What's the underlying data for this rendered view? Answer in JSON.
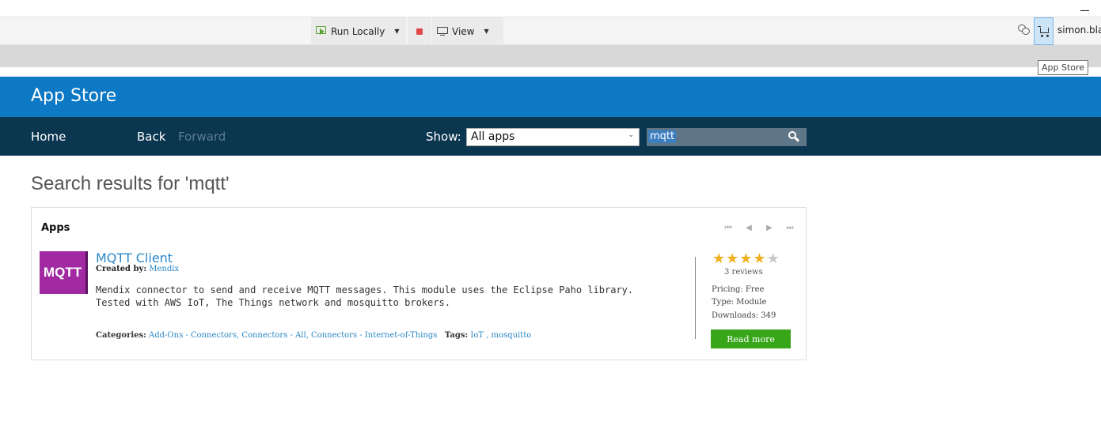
{
  "toolbar": {
    "run_label": "Run Locally",
    "view_label": "View",
    "user_name": "simon.blac",
    "tooltip": "App Store"
  },
  "store": {
    "title": "App Store",
    "nav": {
      "home": "Home",
      "back": "Back",
      "forward": "Forward"
    },
    "show_label": "Show:",
    "show_selected": "All apps",
    "search_value": "mqtt"
  },
  "results": {
    "title": "Search results for 'mqtt'",
    "section_heading": "Apps",
    "items": [
      {
        "logo_text": "MQTT",
        "name": "MQTT Client",
        "created_label": "Created by:",
        "creator": "Mendix",
        "description": "Mendix connector to send and receive MQTT messages. This module uses the Eclipse Paho library. Tested with AWS IoT, The Things network and mosquitto brokers.",
        "categories_label": "Categories:",
        "categories": "Add-Ons - Connectors, Connectors - All, Connectors - Internet-of-Things",
        "tags_label": "Tags:",
        "tags": "IoT , mosquitto",
        "rating": 4,
        "rating_max": 5,
        "reviews": "3 reviews",
        "pricing": "Pricing: Free",
        "type": "Type: Module",
        "downloads": "Downloads: 349",
        "read_more": "Read more"
      }
    ]
  },
  "colors": {
    "header_blue": "#0d79c4",
    "nav_dark": "#0b3650",
    "link_blue": "#2b88c8",
    "read_more_green": "#39a61a",
    "logo_purple": "#a12aa3",
    "star_gold": "#f2b01e"
  }
}
